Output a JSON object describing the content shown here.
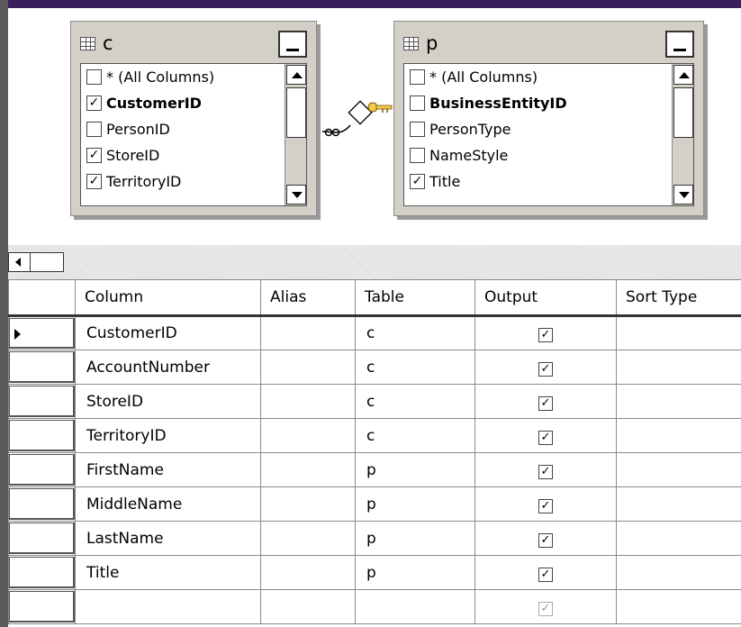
{
  "colors": {
    "accent": "#3a1f5c",
    "frame": "#5a5a5a"
  },
  "tables": [
    {
      "alias": "c",
      "columns": [
        {
          "label": "* (All Columns)",
          "checked": false,
          "bold": false
        },
        {
          "label": "CustomerID",
          "checked": true,
          "bold": true
        },
        {
          "label": "PersonID",
          "checked": false,
          "bold": false
        },
        {
          "label": "StoreID",
          "checked": true,
          "bold": false
        },
        {
          "label": "TerritoryID",
          "checked": true,
          "bold": false
        }
      ]
    },
    {
      "alias": "p",
      "columns": [
        {
          "label": "* (All Columns)",
          "checked": false,
          "bold": false
        },
        {
          "label": "BusinessEntityID",
          "checked": false,
          "bold": true
        },
        {
          "label": "PersonType",
          "checked": false,
          "bold": false
        },
        {
          "label": "NameStyle",
          "checked": false,
          "bold": false
        },
        {
          "label": "Title",
          "checked": true,
          "bold": false
        }
      ]
    }
  ],
  "grid": {
    "headers": [
      "",
      "Column",
      "Alias",
      "Table",
      "Output",
      "Sort Type"
    ],
    "rows": [
      {
        "column": "CustomerID",
        "alias": "",
        "table": "c",
        "output": true,
        "current": true
      },
      {
        "column": "AccountNumber",
        "alias": "",
        "table": "c",
        "output": true
      },
      {
        "column": "StoreID",
        "alias": "",
        "table": "c",
        "output": true
      },
      {
        "column": "TerritoryID",
        "alias": "",
        "table": "c",
        "output": true
      },
      {
        "column": "FirstName",
        "alias": "",
        "table": "p",
        "output": true
      },
      {
        "column": "MiddleName",
        "alias": "",
        "table": "p",
        "output": true
      },
      {
        "column": "LastName",
        "alias": "",
        "table": "p",
        "output": true
      },
      {
        "column": "Title",
        "alias": "",
        "table": "p",
        "output": true
      },
      {
        "column": "",
        "alias": "",
        "table": "",
        "output": true,
        "disabled": true
      }
    ]
  }
}
